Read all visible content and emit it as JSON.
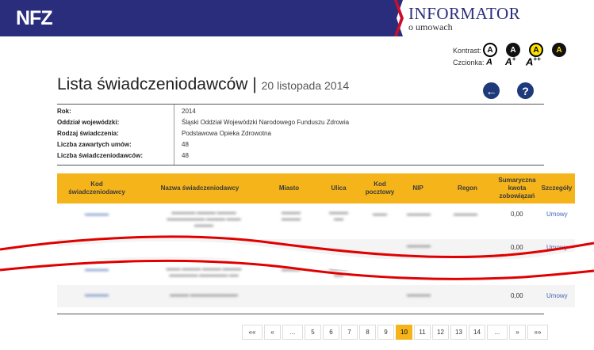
{
  "header": {
    "logo": "NFZ",
    "informator_title": "INFORMATOR",
    "informator_subtitle": "o umowach"
  },
  "accessibility": {
    "contrast_label": "Kontrast:",
    "font_label": "Czcionka:",
    "contrast_options": [
      "A",
      "A",
      "A",
      "A"
    ],
    "font_options": [
      "A",
      "A",
      "A"
    ],
    "font_sups": [
      "",
      "+",
      "++"
    ]
  },
  "page": {
    "title": "Lista świadczeniodawców",
    "separator": "|",
    "date": "20 listopada 2014",
    "back_icon": "arrow-left-icon",
    "help_icon": "question-icon"
  },
  "info": [
    {
      "label": "Rok:",
      "value": "2014"
    },
    {
      "label": "Oddział wojewódzki:",
      "value": "Śląski Oddział Wojewódzki Narodowego Funduszu Zdrowia"
    },
    {
      "label": "Rodzaj świadczenia:",
      "value": "Podstawowa Opieka Zdrowotna"
    },
    {
      "label": "Liczba zawartych umów:",
      "value": "48"
    },
    {
      "label": "Liczba świadczeniodawców:",
      "value": "48"
    }
  ],
  "table": {
    "headers": [
      "Kod\nświadczeniodawcy",
      "Nazwa świadczeniodawcy",
      "Miasto",
      "Ulica",
      "Kod\npocztowy",
      "NIP",
      "Regon",
      "Sumaryczna\nkwota\nzobowiązań",
      "Szczegóły"
    ],
    "rows": [
      {
        "amount": "0,00",
        "details": "Umowy"
      },
      {
        "amount": "0,00",
        "details": "Umowy"
      },
      {
        "amount": "",
        "details": ""
      },
      {
        "amount": "0,00",
        "details": "Umowy"
      }
    ]
  },
  "pagination": {
    "items": [
      "««",
      "«",
      "...",
      "5",
      "6",
      "7",
      "8",
      "9",
      "10",
      "11",
      "12",
      "13",
      "14",
      "...",
      "»",
      "»»"
    ],
    "active": "10"
  },
  "colors": {
    "header_bg": "#2a2d7c",
    "accent": "#f4b41a",
    "link": "#4467b5",
    "annotation": "#e00000"
  }
}
